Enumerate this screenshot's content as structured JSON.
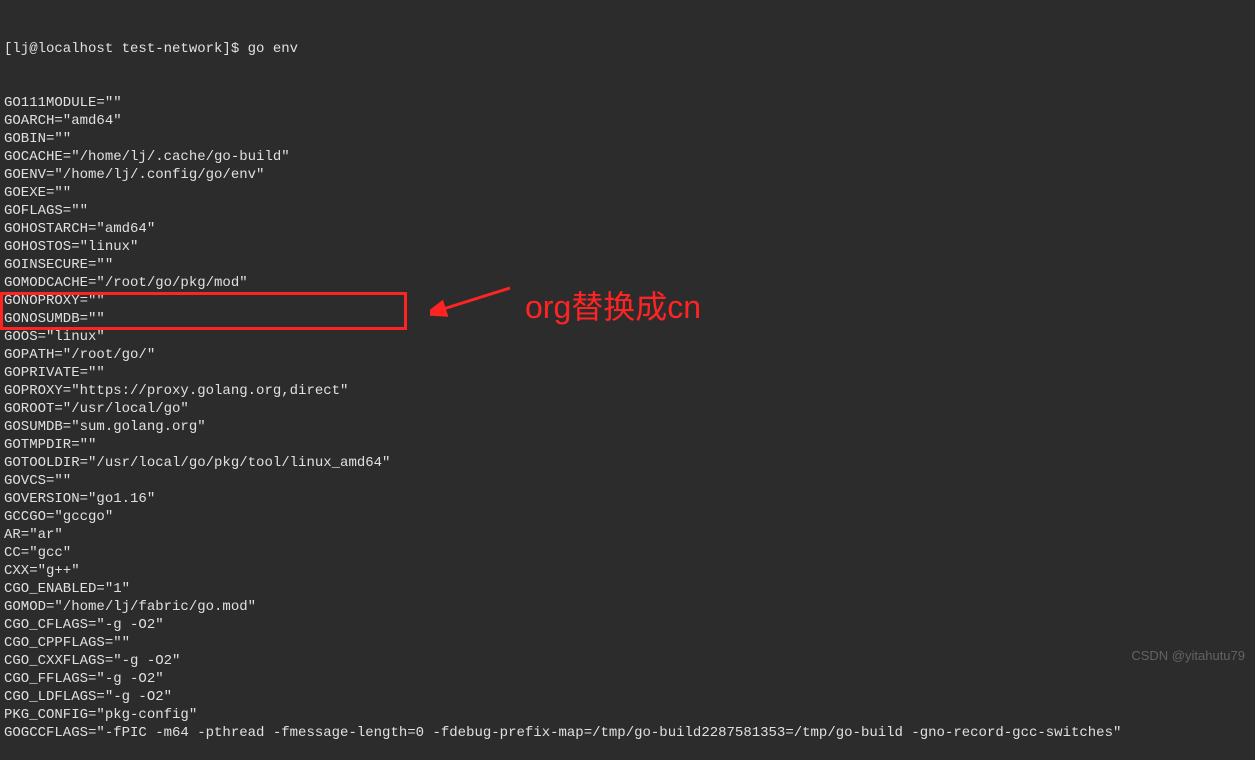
{
  "prompt": "[lj@localhost test-network]$ go env",
  "lines": [
    "GO111MODULE=\"\"",
    "GOARCH=\"amd64\"",
    "GOBIN=\"\"",
    "GOCACHE=\"/home/lj/.cache/go-build\"",
    "GOENV=\"/home/lj/.config/go/env\"",
    "GOEXE=\"\"",
    "GOFLAGS=\"\"",
    "GOHOSTARCH=\"amd64\"",
    "GOHOSTOS=\"linux\"",
    "GOINSECURE=\"\"",
    "GOMODCACHE=\"/root/go/pkg/mod\"",
    "GONOPROXY=\"\"",
    "GONOSUMDB=\"\"",
    "GOOS=\"linux\"",
    "GOPATH=\"/root/go/\"",
    "GOPRIVATE=\"\"",
    "GOPROXY=\"https://proxy.golang.org,direct\"",
    "GOROOT=\"/usr/local/go\"",
    "GOSUMDB=\"sum.golang.org\"",
    "GOTMPDIR=\"\"",
    "GOTOOLDIR=\"/usr/local/go/pkg/tool/linux_amd64\"",
    "GOVCS=\"\"",
    "GOVERSION=\"go1.16\"",
    "GCCGO=\"gccgo\"",
    "AR=\"ar\"",
    "CC=\"gcc\"",
    "CXX=\"g++\"",
    "CGO_ENABLED=\"1\"",
    "GOMOD=\"/home/lj/fabric/go.mod\"",
    "CGO_CFLAGS=\"-g -O2\"",
    "CGO_CPPFLAGS=\"\"",
    "CGO_CXXFLAGS=\"-g -O2\"",
    "CGO_FFLAGS=\"-g -O2\"",
    "CGO_LDFLAGS=\"-g -O2\"",
    "PKG_CONFIG=\"pkg-config\"",
    "GOGCCFLAGS=\"-fPIC -m64 -pthread -fmessage-length=0 -fdebug-prefix-map=/tmp/go-build2287581353=/tmp/go-build -gno-record-gcc-switches\""
  ],
  "annotation": "org替换成cn",
  "watermark": "CSDN @yitahutu79"
}
